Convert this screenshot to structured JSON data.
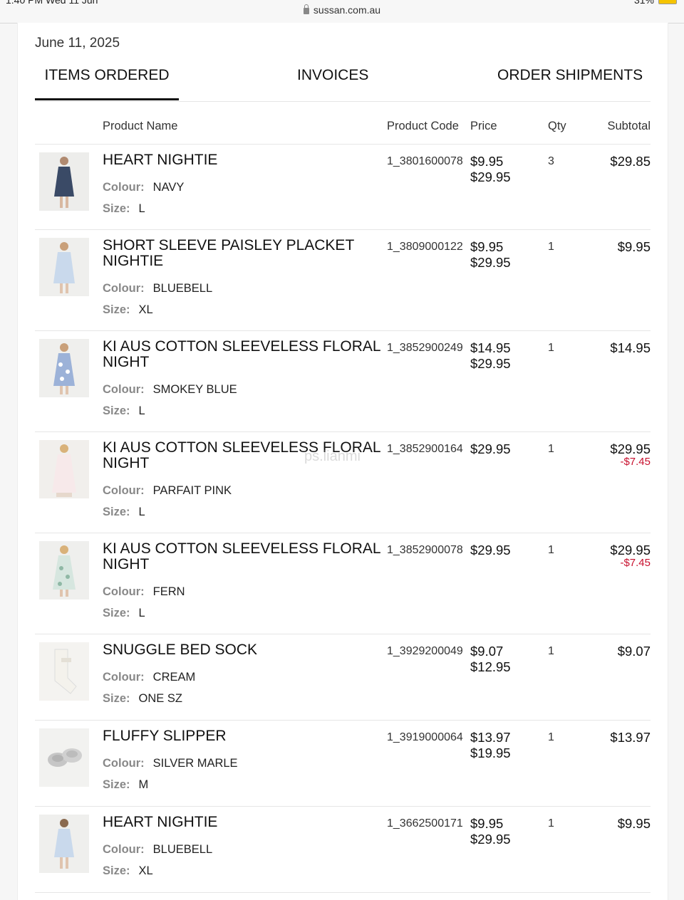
{
  "status": {
    "time": "1:40 PM",
    "day": "Wed 11 Jun",
    "battery": "31%"
  },
  "browser": {
    "url": "sussan.com.au"
  },
  "order": {
    "date": "June 11, 2025"
  },
  "tabs": [
    "ITEMS ORDERED",
    "INVOICES",
    "ORDER SHIPMENTS"
  ],
  "table": {
    "headers": {
      "name": "Product Name",
      "code": "Product Code",
      "price": "Price",
      "qty": "Qty",
      "subtotal": "Subtotal"
    },
    "colour_label": "Colour:",
    "size_label": "Size:"
  },
  "items": [
    {
      "name": "HEART NIGHTIE",
      "colour": "NAVY",
      "size": "L",
      "code": "1_3801600078",
      "price": "$9.95",
      "original_price": "$29.95",
      "qty": "3",
      "subtotal": "$29.85",
      "discount": ""
    },
    {
      "name": "SHORT SLEEVE PAISLEY PLACKET NIGHTIE",
      "colour": "BLUEBELL",
      "size": "XL",
      "code": "1_3809000122",
      "price": "$9.95",
      "original_price": "$29.95",
      "qty": "1",
      "subtotal": "$9.95",
      "discount": ""
    },
    {
      "name": "KI AUS COTTON SLEEVELESS FLORAL NIGHT",
      "colour": "SMOKEY BLUE",
      "size": "L",
      "code": "1_3852900249",
      "price": "$14.95",
      "original_price": "$29.95",
      "qty": "1",
      "subtotal": "$14.95",
      "discount": ""
    },
    {
      "name": "KI AUS COTTON SLEEVELESS FLORAL NIGHT",
      "colour": "PARFAIT PINK",
      "size": "L",
      "code": "1_3852900164",
      "price": "$29.95",
      "original_price": "",
      "qty": "1",
      "subtotal": "$29.95",
      "discount": "-$7.45"
    },
    {
      "name": "KI AUS COTTON SLEEVELESS FLORAL NIGHT",
      "colour": "FERN",
      "size": "L",
      "code": "1_3852900078",
      "price": "$29.95",
      "original_price": "",
      "qty": "1",
      "subtotal": "$29.95",
      "discount": "-$7.45"
    },
    {
      "name": "SNUGGLE BED SOCK",
      "colour": "CREAM",
      "size": "ONE SZ",
      "code": "1_3929200049",
      "price": "$9.07",
      "original_price": "$12.95",
      "qty": "1",
      "subtotal": "$9.07",
      "discount": ""
    },
    {
      "name": "FLUFFY SLIPPER",
      "colour": "SILVER MARLE",
      "size": "M",
      "code": "1_3919000064",
      "price": "$13.97",
      "original_price": "$19.95",
      "qty": "1",
      "subtotal": "$13.97",
      "discount": ""
    },
    {
      "name": "HEART NIGHTIE",
      "colour": "BLUEBELL",
      "size": "XL",
      "code": "1_3662500171",
      "price": "$9.95",
      "original_price": "$29.95",
      "qty": "1",
      "subtotal": "$9.95",
      "discount": ""
    }
  ],
  "watermark": "ps.lianmi",
  "colors": {
    "discount": "#c8102e",
    "navy": "#3a4a66",
    "bluebell": "#c9d9ec",
    "smokey_blue": "#9cb2d8",
    "parfait_pink": "#f7e9ea",
    "fern": "#d6e6df",
    "cream": "#f4f2ec",
    "silver_marle": "#c6c6c6"
  }
}
